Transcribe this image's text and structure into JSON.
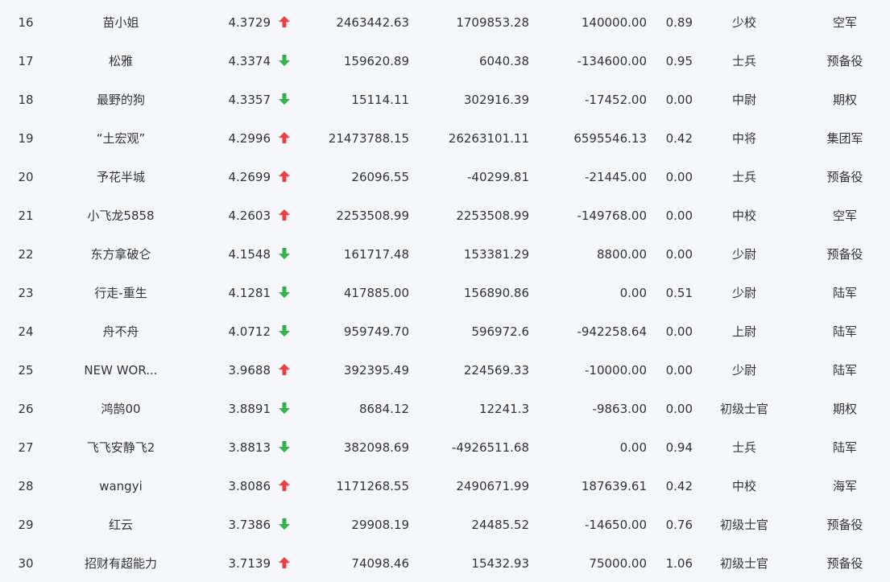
{
  "colors": {
    "up": "#e84141",
    "down": "#35b34a",
    "text": "#333333",
    "background": "#f5f7fa"
  },
  "rows": [
    {
      "rank": "16",
      "name": "苗小姐",
      "score": "4.3729",
      "trend": "up",
      "v1": "2463442.63",
      "v2": "1709853.28",
      "v3": "140000.00",
      "v4": "0.89",
      "title": "少校",
      "unit": "空军"
    },
    {
      "rank": "17",
      "name": "松雅",
      "score": "4.3374",
      "trend": "down",
      "v1": "159620.89",
      "v2": "6040.38",
      "v3": "-134600.00",
      "v4": "0.95",
      "title": "士兵",
      "unit": "预备役"
    },
    {
      "rank": "18",
      "name": "最野的狗",
      "score": "4.3357",
      "trend": "down",
      "v1": "15114.11",
      "v2": "302916.39",
      "v3": "-17452.00",
      "v4": "0.00",
      "title": "中尉",
      "unit": "期权"
    },
    {
      "rank": "19",
      "name": "“土宏观”",
      "score": "4.2996",
      "trend": "up",
      "v1": "21473788.15",
      "v2": "26263101.11",
      "v3": "6595546.13",
      "v4": "0.42",
      "title": "中将",
      "unit": "集团军"
    },
    {
      "rank": "20",
      "name": "予花半城",
      "score": "4.2699",
      "trend": "up",
      "v1": "26096.55",
      "v2": "-40299.81",
      "v3": "-21445.00",
      "v4": "0.00",
      "title": "士兵",
      "unit": "预备役"
    },
    {
      "rank": "21",
      "name": "小飞龙5858",
      "score": "4.2603",
      "trend": "up",
      "v1": "2253508.99",
      "v2": "2253508.99",
      "v3": "-149768.00",
      "v4": "0.00",
      "title": "中校",
      "unit": "空军"
    },
    {
      "rank": "22",
      "name": "东方拿破仑",
      "score": "4.1548",
      "trend": "down",
      "v1": "161717.48",
      "v2": "153381.29",
      "v3": "8800.00",
      "v4": "0.00",
      "title": "少尉",
      "unit": "预备役"
    },
    {
      "rank": "23",
      "name": "行走-重生",
      "score": "4.1281",
      "trend": "down",
      "v1": "417885.00",
      "v2": "156890.86",
      "v3": "0.00",
      "v4": "0.51",
      "title": "少尉",
      "unit": "陆军"
    },
    {
      "rank": "24",
      "name": "舟不舟",
      "score": "4.0712",
      "trend": "down",
      "v1": "959749.70",
      "v2": "596972.6",
      "v3": "-942258.64",
      "v4": "0.00",
      "title": "上尉",
      "unit": "陆军"
    },
    {
      "rank": "25",
      "name": "NEW WOR...",
      "score": "3.9688",
      "trend": "up",
      "v1": "392395.49",
      "v2": "224569.33",
      "v3": "-10000.00",
      "v4": "0.00",
      "title": "少尉",
      "unit": "陆军"
    },
    {
      "rank": "26",
      "name": "鸿鹄00",
      "score": "3.8891",
      "trend": "down",
      "v1": "8684.12",
      "v2": "12241.3",
      "v3": "-9863.00",
      "v4": "0.00",
      "title": "初级士官",
      "unit": "期权"
    },
    {
      "rank": "27",
      "name": "飞飞安静飞2",
      "score": "3.8813",
      "trend": "down",
      "v1": "382098.69",
      "v2": "-4926511.68",
      "v3": "0.00",
      "v4": "0.94",
      "title": "士兵",
      "unit": "陆军"
    },
    {
      "rank": "28",
      "name": "wangyi",
      "score": "3.8086",
      "trend": "up",
      "v1": "1171268.55",
      "v2": "2490671.99",
      "v3": "187639.61",
      "v4": "0.42",
      "title": "中校",
      "unit": "海军"
    },
    {
      "rank": "29",
      "name": "红云",
      "score": "3.7386",
      "trend": "down",
      "v1": "29908.19",
      "v2": "24485.52",
      "v3": "-14650.00",
      "v4": "0.76",
      "title": "初级士官",
      "unit": "预备役"
    },
    {
      "rank": "30",
      "name": "招财有超能力",
      "score": "3.7139",
      "trend": "up",
      "v1": "74098.46",
      "v2": "15432.93",
      "v3": "75000.00",
      "v4": "1.06",
      "title": "初级士官",
      "unit": "预备役"
    }
  ]
}
